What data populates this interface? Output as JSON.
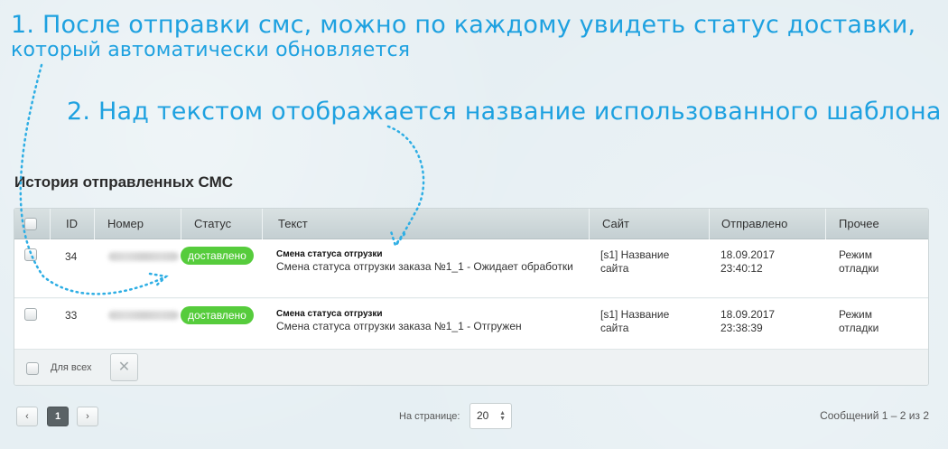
{
  "annotations": {
    "note1_line1": "1. После отправки смс, можно по каждому увидеть статус доставки,",
    "note1_line2": "который автоматически обновляется",
    "note2": "2. Над текстом отображается название использованного шаблона"
  },
  "page": {
    "title": "История отправленных СМС"
  },
  "table": {
    "headers": [
      "",
      "ID",
      "Номер",
      "Статус",
      "Текст",
      "Сайт",
      "Отправлено",
      "Прочее"
    ],
    "rows": [
      {
        "id": "34",
        "status": "доставлено",
        "template_name": "Смена статуса отгрузки",
        "text": "Смена статуса отгрузки заказа №1_1 - Ожидает обработки",
        "site": "[s1] Название сайта",
        "sent_date": "18.09.2017",
        "sent_time": "23:40:12",
        "other": "Режим отладки"
      },
      {
        "id": "33",
        "status": "доставлено",
        "template_name": "Смена статуса отгрузки",
        "text": "Смена статуса отгрузки заказа №1_1 - Отгружен",
        "site": "[s1] Название сайта",
        "sent_date": "18.09.2017",
        "sent_time": "23:38:39",
        "other": "Режим отладки"
      }
    ],
    "footer": {
      "for_all_label": "Для всех",
      "delete_icon": "close-icon"
    }
  },
  "pagination": {
    "prev_icon": "chevron-left-icon",
    "current_page": "1",
    "next_icon": "chevron-right-icon",
    "per_page_label": "На странице:",
    "per_page_value": "20",
    "total_label": "Сообщений 1 – 2 из 2"
  },
  "colors": {
    "annotation": "#1ea1e0",
    "status_delivered": "#56cc3c"
  }
}
